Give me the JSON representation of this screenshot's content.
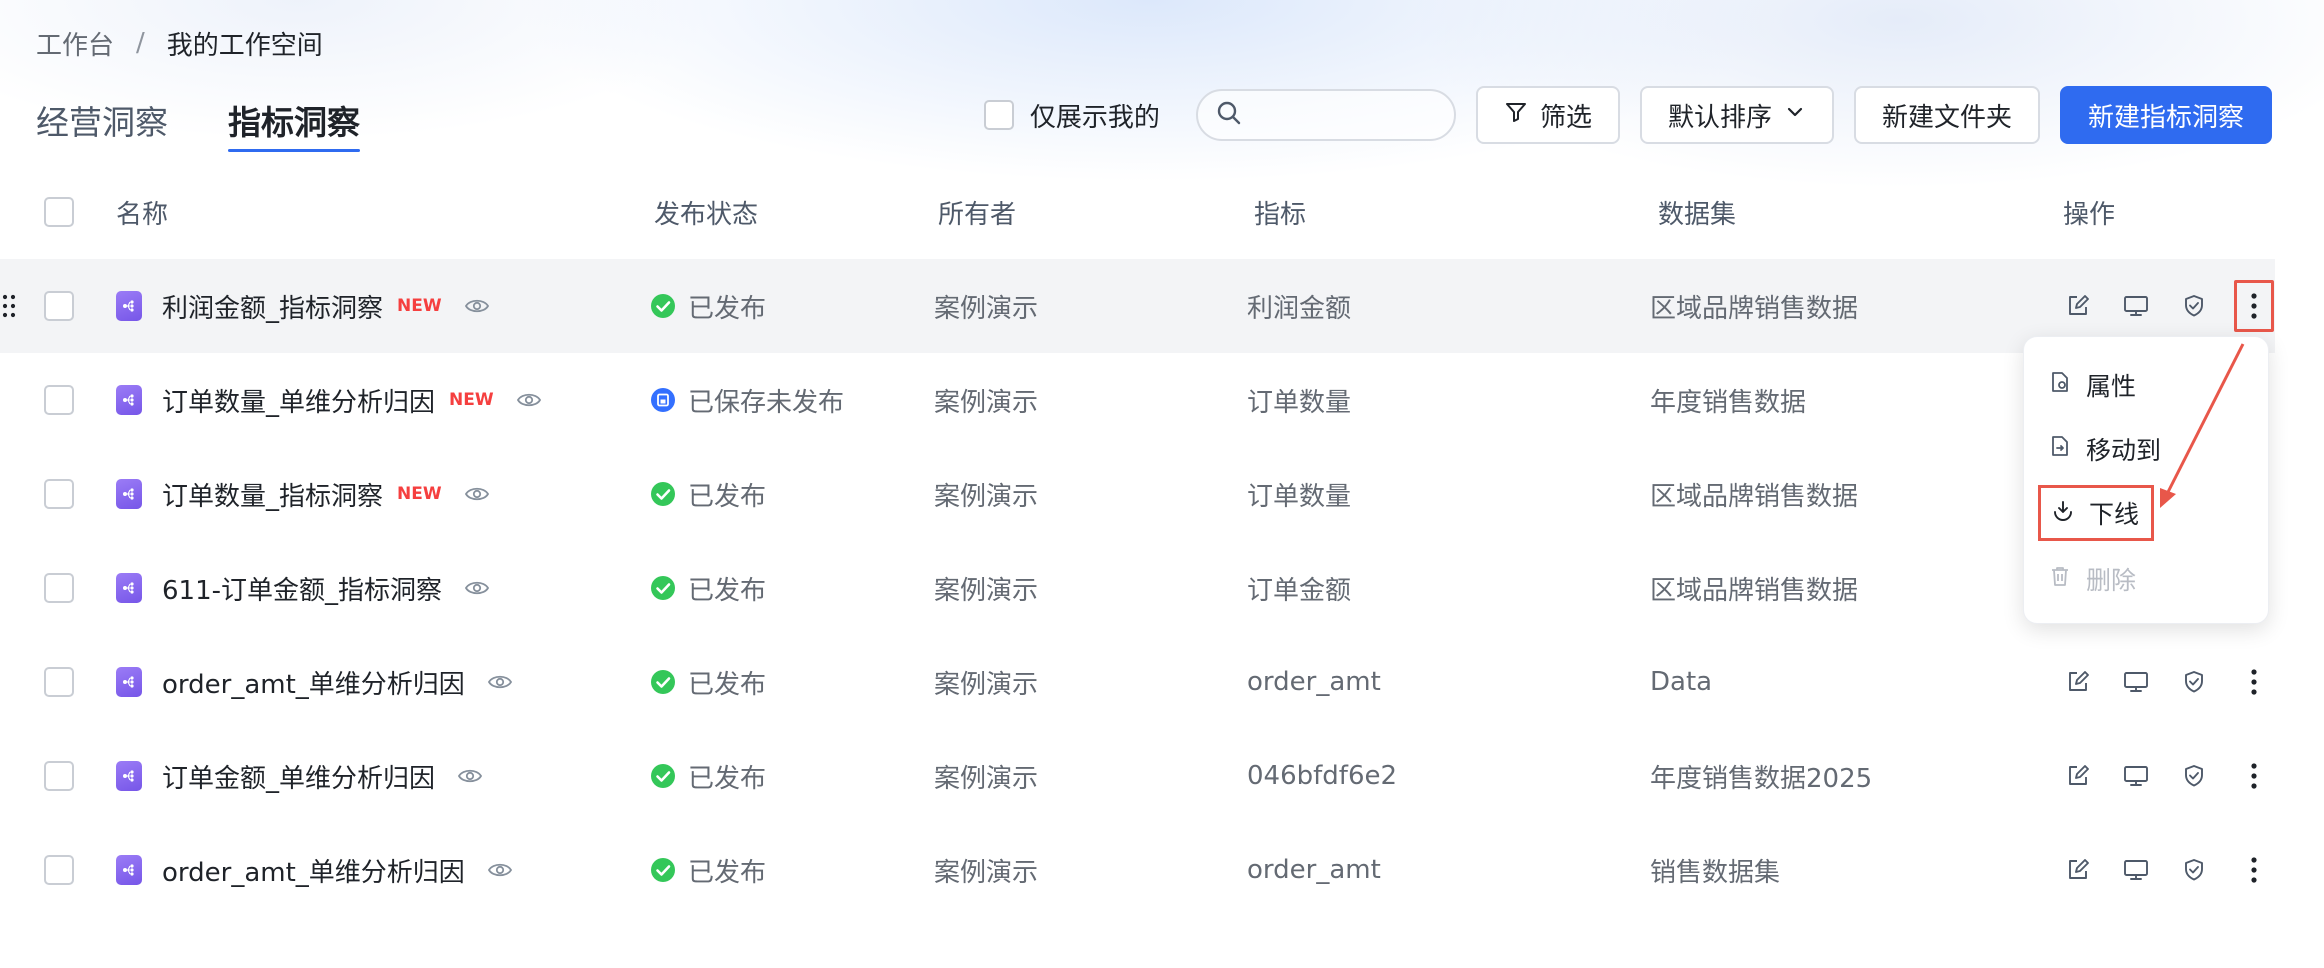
{
  "breadcrumb": {
    "root": "工作台",
    "separator": "/",
    "current": "我的工作空间"
  },
  "tabs": [
    {
      "label": "经营洞察",
      "active": false
    },
    {
      "label": "指标洞察",
      "active": true
    }
  ],
  "toolbar": {
    "only_mine_label": "仅展示我的",
    "search_placeholder": "",
    "filter_label": "筛选",
    "sort_label": "默认排序",
    "new_folder_label": "新建文件夹",
    "new_insight_label": "新建指标洞察"
  },
  "table": {
    "headers": {
      "name": "名称",
      "status": "发布状态",
      "owner": "所有者",
      "metric": "指标",
      "dataset": "数据集",
      "actions": "操作"
    },
    "rows": [
      {
        "name": "利润金额_指标洞察",
        "new": "NEW",
        "status": "已发布",
        "status_type": "published",
        "owner": "案例演示",
        "metric": "利润金额",
        "dataset": "区域品牌销售数据"
      },
      {
        "name": "订单数量_单维分析归因",
        "new": "NEW",
        "status": "已保存未发布",
        "status_type": "saved",
        "owner": "案例演示",
        "metric": "订单数量",
        "dataset": "年度销售数据"
      },
      {
        "name": "订单数量_指标洞察",
        "new": "NEW",
        "status": "已发布",
        "status_type": "published",
        "owner": "案例演示",
        "metric": "订单数量",
        "dataset": "区域品牌销售数据"
      },
      {
        "name": "611-订单金额_指标洞察",
        "new": "",
        "status": "已发布",
        "status_type": "published",
        "owner": "案例演示",
        "metric": "订单金额",
        "dataset": "区域品牌销售数据"
      },
      {
        "name": "order_amt_单维分析归因",
        "new": "",
        "status": "已发布",
        "status_type": "published",
        "owner": "案例演示",
        "metric": "order_amt",
        "dataset": "Data"
      },
      {
        "name": "订单金额_单维分析归因",
        "new": "",
        "status": "已发布",
        "status_type": "published",
        "owner": "案例演示",
        "metric": "046bfdf6e2",
        "dataset": "年度销售数据2025"
      },
      {
        "name": "order_amt_单维分析归因",
        "new": "",
        "status": "已发布",
        "status_type": "published",
        "owner": "案例演示",
        "metric": "order_amt",
        "dataset": "销售数据集"
      }
    ]
  },
  "context_menu": {
    "items": [
      {
        "label": "属性",
        "icon": "property-icon",
        "disabled": false
      },
      {
        "label": "移动到",
        "icon": "move-icon",
        "disabled": false
      },
      {
        "label": "下线",
        "icon": "offline-icon",
        "disabled": false,
        "highlighted": true
      },
      {
        "label": "删除",
        "icon": "trash-icon",
        "disabled": true
      }
    ]
  },
  "colors": {
    "primary": "#2f6bf0",
    "success": "#34c759",
    "saved": "#3370ff",
    "accent_purple": "#7c5cf0",
    "new_badge": "#f53f3f",
    "highlight_border": "#e8574a"
  }
}
